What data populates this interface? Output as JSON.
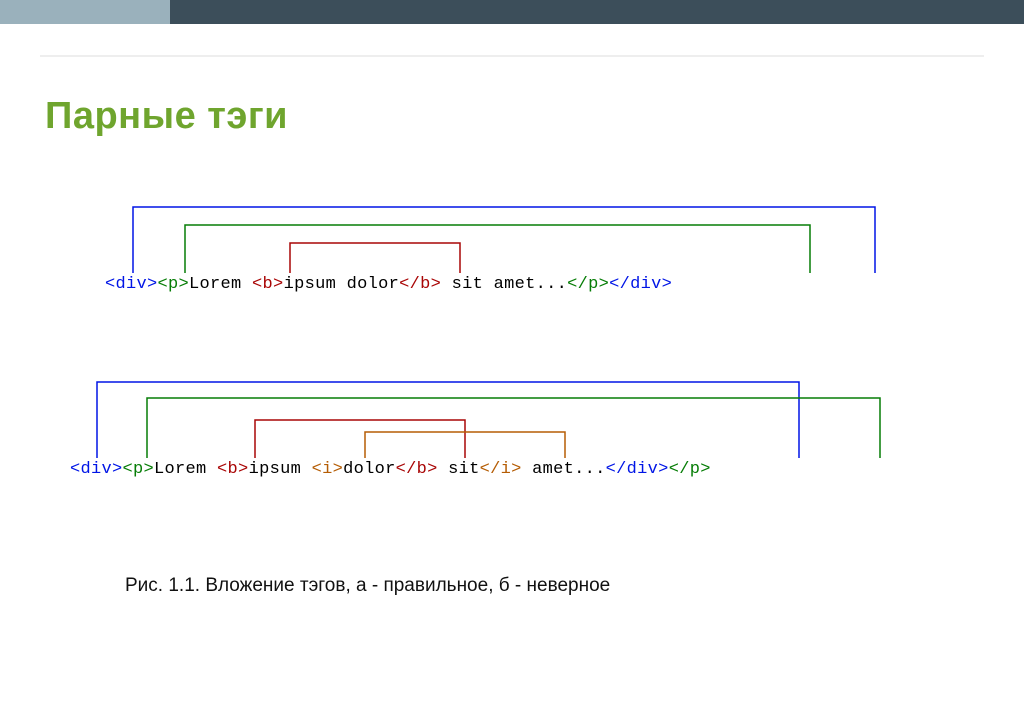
{
  "title": "Парные тэги",
  "caption": "Рис. 1.1. Вложение тэгов, а - правильное, б - неверное",
  "example_a": {
    "seg0": "<div>",
    "seg1": "<p>",
    "seg2": "Lorem ",
    "seg3": "<b>",
    "seg4": "ipsum dolor",
    "seg5": "</b>",
    "seg6": " sit amet...",
    "seg7": "</p>",
    "seg8": "</div>"
  },
  "example_b": {
    "seg0": "<div>",
    "seg1": "<p>",
    "seg2": "Lorem ",
    "seg3": "<b>",
    "seg4": "ipsum ",
    "seg5": "<i>",
    "seg6": "dolor",
    "seg7": "</b>",
    "seg8": " sit",
    "seg9": "</i>",
    "seg10": " amet...",
    "seg11": "</div>",
    "seg12": "</p>"
  }
}
